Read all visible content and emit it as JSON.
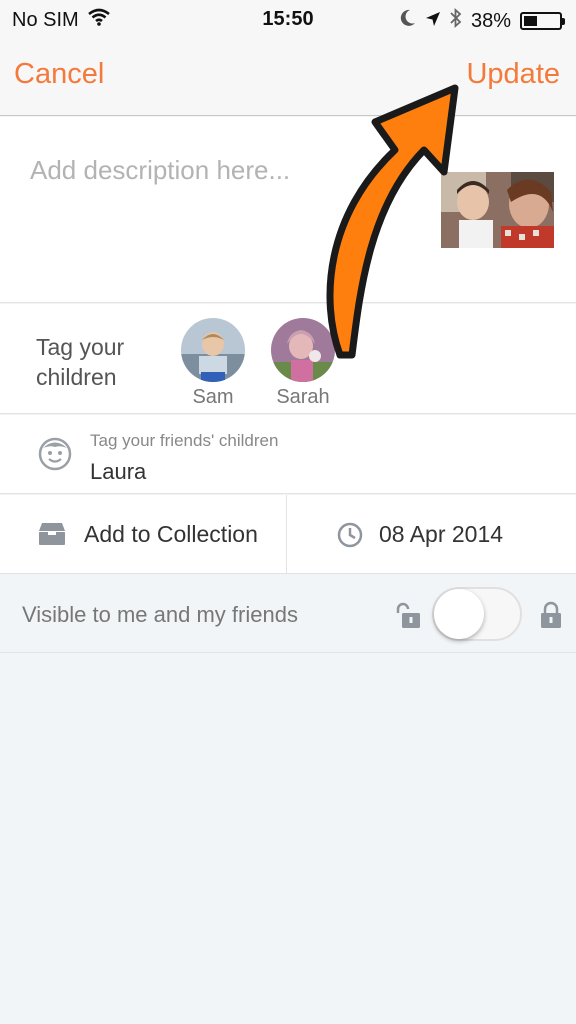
{
  "status_bar": {
    "carrier": "No SIM",
    "time": "15:50",
    "battery_percent_label": "38%",
    "battery_level": 0.38
  },
  "nav": {
    "cancel_label": "Cancel",
    "update_label": "Update",
    "accent_color": "#f47a3b"
  },
  "description": {
    "placeholder": "Add description here..."
  },
  "tag_children": {
    "label": "Tag your children",
    "children": [
      {
        "name": "Sam"
      },
      {
        "name": "Sarah"
      }
    ]
  },
  "friends_children": {
    "label": "Tag your friends' children",
    "value": "Laura"
  },
  "collection": {
    "label": "Add to Collection"
  },
  "date": {
    "label": "08 Apr 2014"
  },
  "visibility": {
    "label": "Visible to me and my friends",
    "toggle_on": false
  },
  "annotation": {
    "arrow_color": "#ff7f0e",
    "points_to": "update-button"
  }
}
